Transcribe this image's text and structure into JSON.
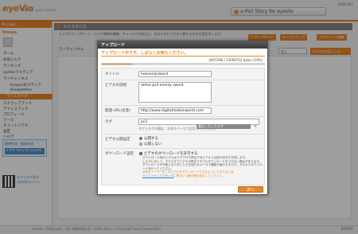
{
  "header": {
    "logo": "eyeVio",
    "tagline": "My life, your emotion",
    "top_link": "SIGN OUT",
    "banner": "x-Pict Story for eyeVio"
  },
  "sidebar": {
    "section_label": "My page",
    "user_name": "hisaya",
    "items": [
      "ホーム",
      "お気に入り",
      "ランキング",
      "eyeVioでメディア",
      "マイチャンネル"
    ],
    "sub_items": [
      "hisaya1のメディア",
      "dinowattdeo"
    ],
    "selected": "マイスタジオ",
    "items2": [
      "スクラップブック",
      "アドレスブック",
      "プロフィール",
      "ツール",
      "チュートリアル",
      "設定",
      "ヘルプ"
    ],
    "promo_text": "簡単作成・動画作成",
    "promo_button": "x-Pict Story for eyeVio",
    "qr_text": "モバイルで見る eyeVioモバイル"
  },
  "main": {
    "title": "マイスタジオ",
    "description": "ビデオのアップロード、ビデオ情報の編集、チャンネル作成など、あなたがビデオを公開するための設定をします。",
    "buttons": [
      "+ アップロード",
      "メールでアップ",
      "プロフィール編集"
    ],
    "tab_labels": [
      "マイチャンネル",
      "スクラップブック"
    ],
    "select_value": "なし",
    "right_button": "ビデオをお気に入り",
    "footer": "eyeVio ご利用の流れ | 個人情報保護方針 | お問い合わせ | Copyright Sony Corporation",
    "sony": "SONY"
  },
  "dialog": {
    "title": "アップロード",
    "message": "アップロード中です。しばらくお待ちください。",
    "progress_text": "4407296 / 23090722 bytes (19%)",
    "progress_percent": 19,
    "fields": {
      "title_label": "タイトル",
      "title_value": "heavenlysword",
      "desc_label": "ビデオの説明",
      "desc_value": "demo ps3 evenly sword",
      "url_label": "関連 URL(任意)",
      "url_value": "http://www.digitalmotionworld.com",
      "tag_label": "タグ",
      "tag_value": "ps3",
      "tag_hint": "タグとタグの間は、半角スペースで区切ってください。",
      "tag_button": "最近入力したタグ",
      "tag_plus": "+",
      "public_label": "ビデオ公開設定",
      "public_option": "公開する",
      "private_option": "公開しない",
      "download_label": "ダウンロード設定",
      "download_check": "ビデオのダウンロードを許可する",
      "download_text_1": "ダウンロード用のビデオはブラウザで再生するビデオとは別の形式で作成します。",
      "download_text_2": "したがいまして、ブラウザでビデオが再生できてもダウンロードができない場合があります。",
      "download_text_3": "ダウンロードが可能になりましたらお知らせメールで通知が届きますので、それからダウンロードを行ってください。",
      "download_text_4": "※他のユーザーがこのビデオをダウンロードできるようにするためには、",
      "download_text_5": "クリエイティブコモンズ",
      "download_text_6": "に基づいて著作権を設定してください。"
    },
    "next_button": "次へ"
  }
}
